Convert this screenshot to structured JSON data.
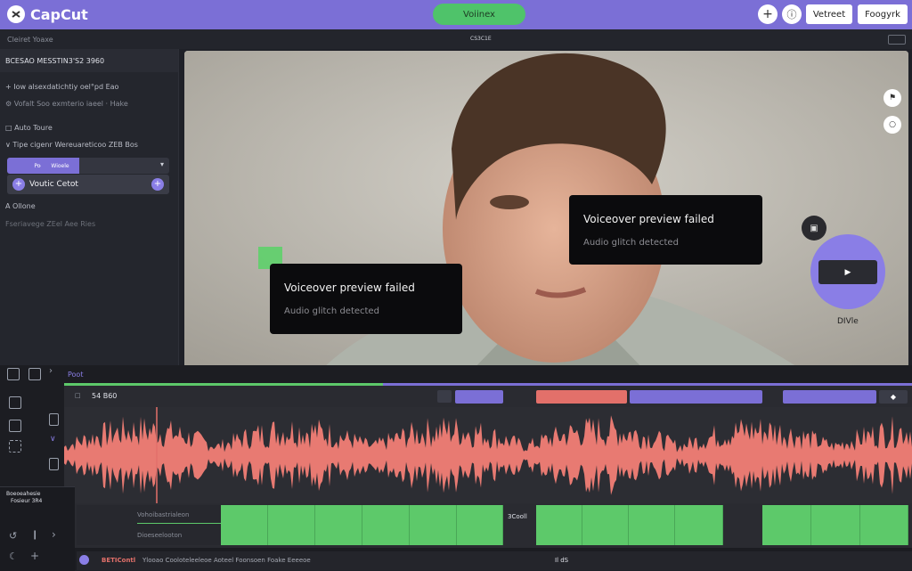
{
  "app": {
    "name": "CapCut"
  },
  "topbar": {
    "center_pill": "Voiinex",
    "plus_icon": "+",
    "info_icon": "ⓘ",
    "button1": "Vetreet",
    "button2": "Foogyrk"
  },
  "subbar": {
    "left": "Cleiret Yoaxe",
    "center": "CS3C1E"
  },
  "sidebar": {
    "header": "BCESAO MESSTIN3'S2 3960",
    "row1": "Iow alsexdatichtiy oel°pd Eao",
    "row2": "Vofalt Soo exmterio iaeel · Hake",
    "section": "Auto Toure",
    "row3": "Tipe cigenr Wereuareticoo ZEB Bos",
    "tab1": "Poeme",
    "tab2": "Wioele",
    "voice_label": "Voutic Cetot",
    "section2": "A Ollone",
    "row4": "Fseriavege ZEel Aee Ries"
  },
  "preview": {
    "toast1": {
      "title": "Voiceover preview failed",
      "subtitle": "Audio glitch detected"
    },
    "toast2": {
      "title": "Voiceover preview failed",
      "subtitle": "Audio glitch detected"
    },
    "side_label": "DIVle"
  },
  "timeline": {
    "label": "Poot",
    "track_header": "54 B60",
    "side_panel_title": "Boeoeahesie",
    "side_panel_sub": "Fosieur 3R4",
    "track_label1": "Vohoibastrialeon",
    "track_label2": "Dioeseelooton",
    "track_label3": "3Cooll",
    "bottom_left": "BETIContl",
    "bottom_center": "Ylooao Cooloteleeleoe Aoteel Foonsoen Foake Eeeeoe",
    "bottom_right": "Il dS"
  },
  "colors": {
    "accent": "#7b6fd6",
    "green": "#5dc96a",
    "waveform": "#e87a72",
    "clip_red": "#e3706a"
  }
}
